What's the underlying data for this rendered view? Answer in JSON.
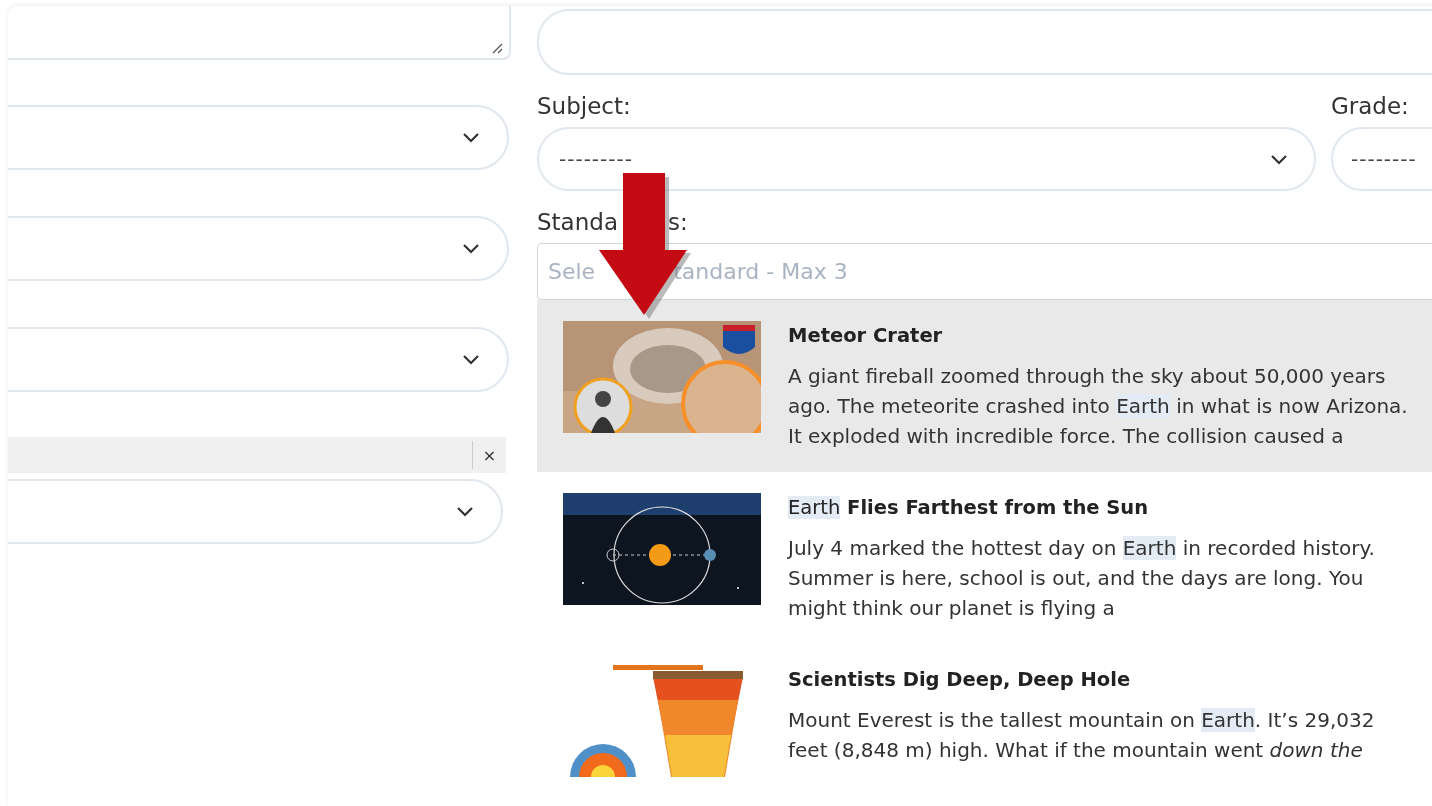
{
  "filters": {
    "clear_symbol": "×"
  },
  "subject": {
    "label": "Subject:",
    "value": "---------"
  },
  "grade": {
    "label": "Grade:",
    "value": "--------"
  },
  "standards": {
    "label": [
      "Standa",
      "s:"
    ],
    "placeholder": [
      "Sele",
      "tandard - Max 3"
    ]
  },
  "results": [
    {
      "selected": true,
      "kind": "picture",
      "title": [
        {
          "text": "Meteor Crater",
          "highlight": false
        }
      ],
      "summary": [
        {
          "text": "A giant fireball zoomed through the sky about 50,000 years ago. The meteorite crashed into ",
          "highlight": false
        },
        {
          "text": "Earth",
          "highlight": true
        },
        {
          "text": " in what is now Arizona. It exploded with incredible force. The collision caused a",
          "highlight": false
        }
      ]
    },
    {
      "selected": false,
      "kind": "picture",
      "title": [
        {
          "text": "Earth",
          "highlight": true
        },
        {
          "text": " **Flies Farthest from the Sun**",
          "highlight": false
        }
      ],
      "summary": [
        {
          "text": "July 4 marked the hottest day on ",
          "highlight": false
        },
        {
          "text": "Earth",
          "highlight": true
        },
        {
          "text": " in recorded history. Summer is here, school is out, and the days are long. You might think our planet is flying a",
          "highlight": false
        }
      ]
    },
    {
      "selected": false,
      "kind": "picture",
      "title": [
        {
          "text": "Scientists Dig Deep, Deep Hole",
          "highlight": false
        }
      ],
      "summary": [
        {
          "text": "Mount Everest is the tallest mountain on ",
          "highlight": false
        },
        {
          "text": "Earth",
          "highlight": true
        },
        {
          "text": ". It’s 29,032 feet (8,848 m) high. What if the mountain went *down the*",
          "highlight": false
        }
      ]
    }
  ]
}
